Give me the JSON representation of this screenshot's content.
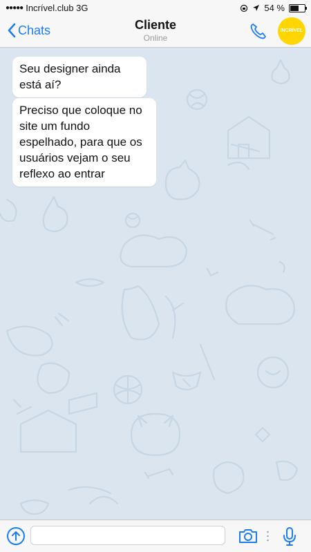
{
  "status": {
    "carrier": "Incrível.club 3G",
    "battery_text": "54 %",
    "battery_level": 0.54
  },
  "nav": {
    "back_label": "Chats",
    "title": "Cliente",
    "subtitle": "Online",
    "avatar_text": "INCRÍVEL"
  },
  "messages": [
    {
      "text": "Seu designer ainda está aí?"
    },
    {
      "text": "Preciso que coloque no site um fundo espelhado, para que os usuários vejam o seu reflexo ao entrar"
    }
  ],
  "input": {
    "value": "",
    "placeholder": ""
  },
  "colors": {
    "accent": "#1b7cf2",
    "chat_background": "#dae5ef",
    "avatar": "#ffd600"
  },
  "icons": [
    "back-chevron-icon",
    "phone-icon",
    "attach-icon",
    "camera-icon",
    "microphone-icon"
  ]
}
